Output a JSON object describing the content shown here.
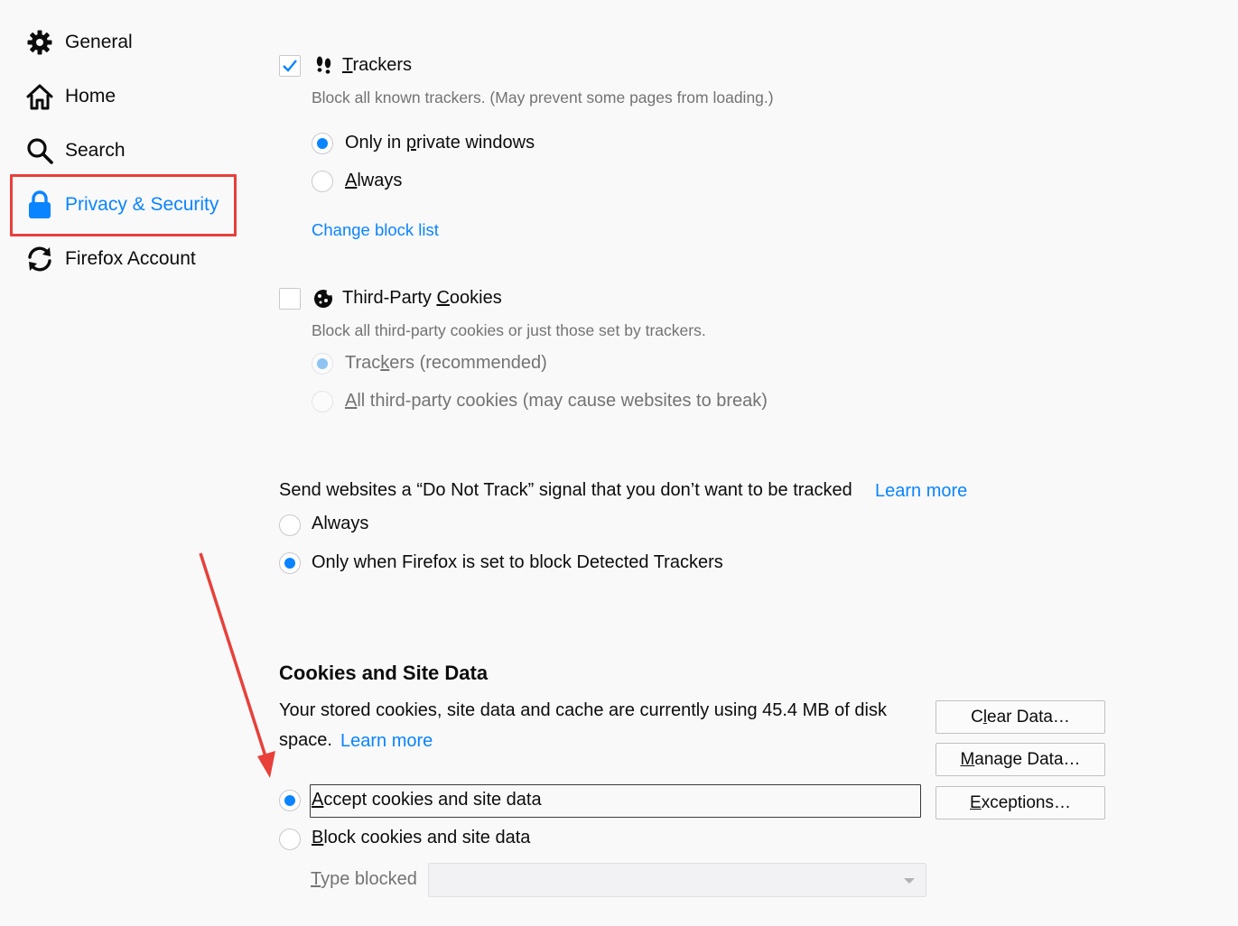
{
  "sidebar": {
    "items": [
      {
        "label": "General",
        "icon": "gear-icon"
      },
      {
        "label": "Home",
        "icon": "home-icon"
      },
      {
        "label": "Search",
        "icon": "search-icon"
      },
      {
        "label": "Privacy & Security",
        "icon": "lock-icon",
        "selected": true
      },
      {
        "label": "Firefox Account",
        "icon": "sync-icon"
      }
    ]
  },
  "trackers": {
    "checked": true,
    "label_key": "T",
    "label_rest": "rackers",
    "description": "Block all known trackers. (May prevent some pages from loading.)",
    "options": {
      "private_pre": "Only in ",
      "private_key": "p",
      "private_post": "rivate windows",
      "always_key": "A",
      "always_rest": "lways"
    },
    "change_link": "Change block list"
  },
  "cookies3p": {
    "checked": false,
    "label_pre": "Third-Party ",
    "label_key": "C",
    "label_post": "ookies",
    "description": "Block all third-party cookies or just those set by trackers.",
    "opt1_pre": "Trac",
    "opt1_key": "k",
    "opt1_post": "ers (recommended)",
    "opt2_key": "A",
    "opt2_post": "ll third-party cookies (may cause websites to break)"
  },
  "dnt": {
    "text": "Send websites a “Do Not Track” signal that you don’t want to be tracked",
    "learn_more": "Learn more",
    "opt_always": "Always",
    "opt_only": "Only when Firefox is set to block Detected Trackers"
  },
  "site_data": {
    "heading": "Cookies and Site Data",
    "usage_line1": "Your stored cookies, site data and cache are currently using 45.4 MB of disk",
    "usage_line2": "space.",
    "learn_more": "Learn more",
    "accept_key": "A",
    "accept_rest": "ccept cookies and site data",
    "block_key": "B",
    "block_rest": "lock cookies and site data",
    "type_key": "T",
    "type_rest": "ype blocked",
    "buttons": {
      "clear_pre": "C",
      "clear_key": "l",
      "clear_post": "ear Data…",
      "manage_key": "M",
      "manage_post": "anage Data…",
      "exceptions_key": "E",
      "exceptions_post": "xceptions…"
    }
  },
  "colors": {
    "accent": "#0a84ff",
    "annotation": "#e8403a"
  }
}
